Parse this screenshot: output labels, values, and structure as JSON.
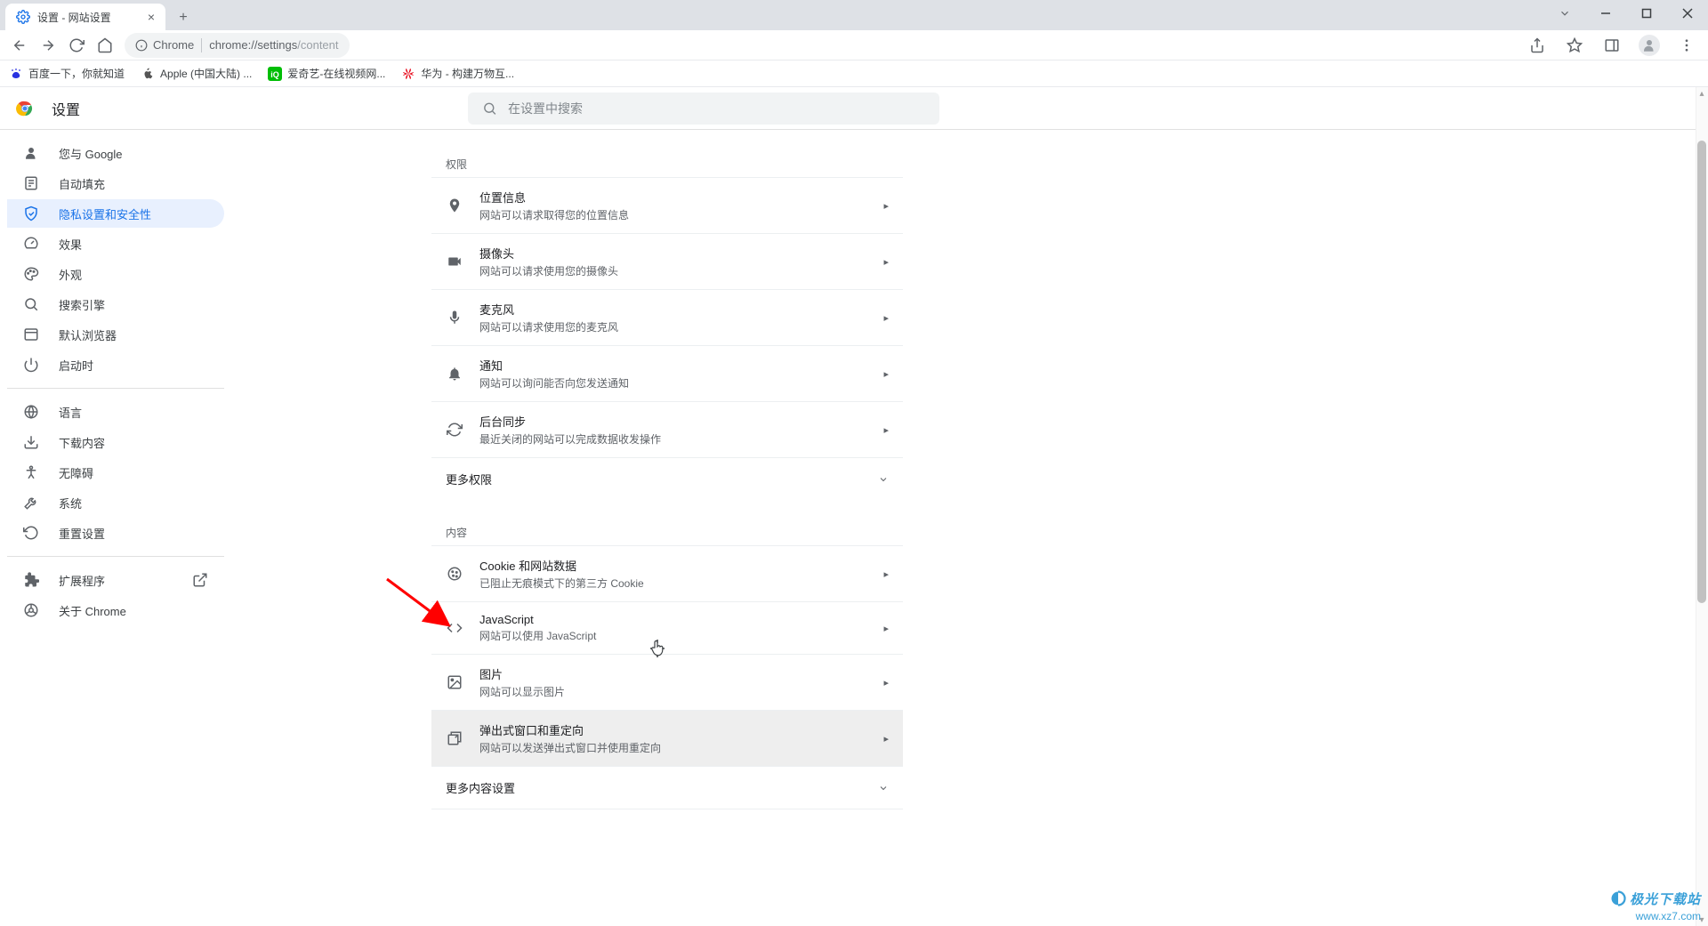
{
  "browser": {
    "tab_title": "设置 - 网站设置",
    "url_host": "Chrome",
    "url_path": "chrome://settings/content",
    "url_display_prefix": "chrome://settings",
    "url_display_suffix": "/content"
  },
  "window_controls": {
    "collapse": "v",
    "minimize": "–",
    "maximize": "☐",
    "close": "✕"
  },
  "bookmarks": [
    {
      "icon": "baidu",
      "label": "百度一下，你就知道"
    },
    {
      "icon": "apple",
      "label": "Apple (中国大陆) ..."
    },
    {
      "icon": "iqiyi",
      "label": "爱奇艺-在线视频网..."
    },
    {
      "icon": "huawei",
      "label": "华为 - 构建万物互..."
    }
  ],
  "settings": {
    "title": "设置",
    "search_placeholder": "在设置中搜索",
    "sidebar": [
      {
        "id": "you-google",
        "icon": "person",
        "label": "您与 Google"
      },
      {
        "id": "autofill",
        "icon": "autofill",
        "label": "自动填充"
      },
      {
        "id": "privacy",
        "icon": "shield",
        "label": "隐私设置和安全性",
        "active": true
      },
      {
        "id": "performance",
        "icon": "speed",
        "label": "效果"
      },
      {
        "id": "appearance",
        "icon": "palette",
        "label": "外观"
      },
      {
        "id": "search",
        "icon": "search",
        "label": "搜索引擎"
      },
      {
        "id": "default-browser",
        "icon": "browser",
        "label": "默认浏览器"
      },
      {
        "id": "startup",
        "icon": "power",
        "label": "启动时"
      }
    ],
    "sidebar2": [
      {
        "id": "language",
        "icon": "globe",
        "label": "语言"
      },
      {
        "id": "downloads",
        "icon": "download",
        "label": "下载内容"
      },
      {
        "id": "accessibility",
        "icon": "accessibility",
        "label": "无障碍"
      },
      {
        "id": "system",
        "icon": "wrench",
        "label": "系统"
      },
      {
        "id": "reset",
        "icon": "restore",
        "label": "重置设置"
      }
    ],
    "sidebar3": [
      {
        "id": "extensions",
        "icon": "extension",
        "label": "扩展程序",
        "external": true
      },
      {
        "id": "about",
        "icon": "about-chrome",
        "label": "关于 Chrome"
      }
    ]
  },
  "content": {
    "section_permissions": "权限",
    "permissions": [
      {
        "id": "location",
        "icon": "location",
        "title": "位置信息",
        "sub": "网站可以请求取得您的位置信息"
      },
      {
        "id": "camera",
        "icon": "camera",
        "title": "摄像头",
        "sub": "网站可以请求使用您的摄像头"
      },
      {
        "id": "microphone",
        "icon": "mic",
        "title": "麦克风",
        "sub": "网站可以请求使用您的麦克风"
      },
      {
        "id": "notifications",
        "icon": "bell",
        "title": "通知",
        "sub": "网站可以询问能否向您发送通知"
      },
      {
        "id": "background-sync",
        "icon": "sync",
        "title": "后台同步",
        "sub": "最近关闭的网站可以完成数据收发操作"
      }
    ],
    "more_permissions": "更多权限",
    "section_content": "内容",
    "content_rows": [
      {
        "id": "cookies",
        "icon": "cookie",
        "title": "Cookie 和网站数据",
        "sub": "已阻止无痕模式下的第三方 Cookie"
      },
      {
        "id": "javascript",
        "icon": "code",
        "title": "JavaScript",
        "sub": "网站可以使用 JavaScript"
      },
      {
        "id": "images",
        "icon": "image",
        "title": "图片",
        "sub": "网站可以显示图片"
      },
      {
        "id": "popups",
        "icon": "popup",
        "title": "弹出式窗口和重定向",
        "sub": "网站可以发送弹出式窗口并使用重定向",
        "hovered": true
      }
    ],
    "more_content": "更多内容设置"
  },
  "watermark": {
    "line1": "极光下载站",
    "line2": "www.xz7.com"
  }
}
